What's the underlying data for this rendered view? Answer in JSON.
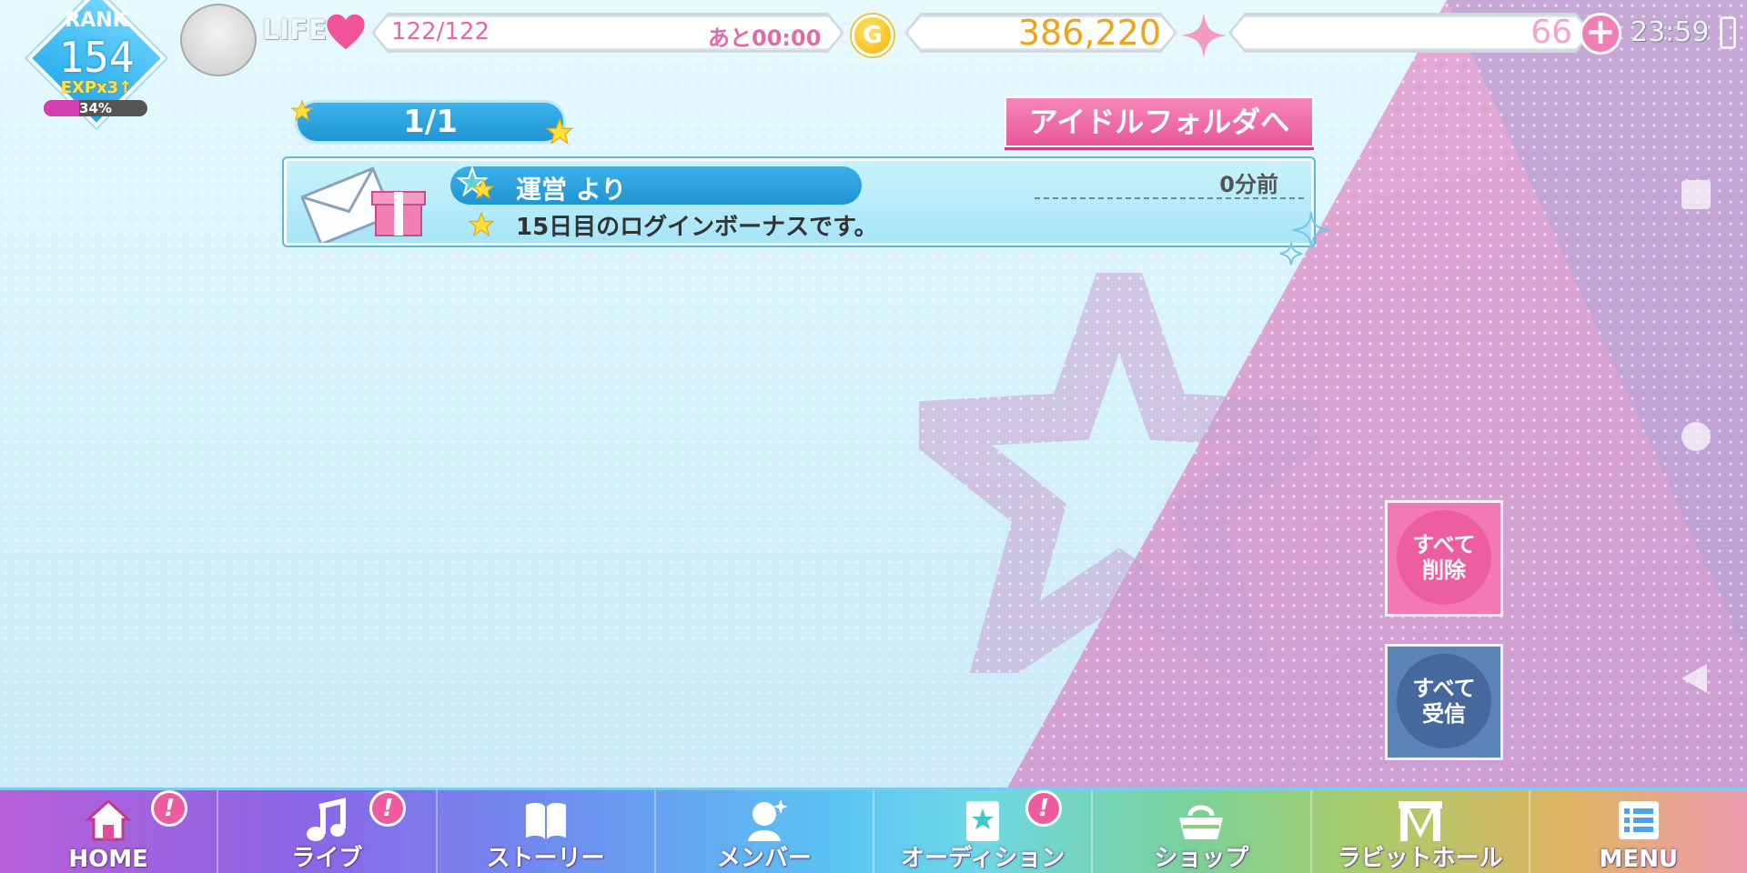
{
  "hud": {
    "rank_label": "RANK",
    "rank_value": "154",
    "exp_boost": "EXPx3↑",
    "exp_percent_text": "34%",
    "exp_progress": 0.34,
    "life_label": "LIFE",
    "life_value": "122/122",
    "life_timer": "あと00:00",
    "gold_icon": "G",
    "gold_value": "386,220",
    "jewel_value": "66",
    "plus_icon": "+",
    "clock": "23:59"
  },
  "content": {
    "page_indicator": "1/1",
    "folder_button": "アイドルフォルダへ",
    "messages": [
      {
        "sender": "運営 より",
        "time": "0分前",
        "body": "15日目のログインボーナスです。"
      }
    ],
    "delete_all": "すべて\n削除",
    "receive_all": "すべて\n受信"
  },
  "bottom_nav": [
    {
      "label": "HOME",
      "icon": "home-icon",
      "badge": "!"
    },
    {
      "label": "ライブ",
      "icon": "music-note-icon",
      "badge": "!"
    },
    {
      "label": "ストーリー",
      "icon": "book-icon",
      "badge": ""
    },
    {
      "label": "メンバー",
      "icon": "member-icon",
      "badge": ""
    },
    {
      "label": "オーディション",
      "icon": "audition-icon",
      "badge": "!"
    },
    {
      "label": "ショップ",
      "icon": "basket-icon",
      "badge": ""
    },
    {
      "label": "ラビットホール",
      "icon": "stage-icon",
      "badge": ""
    },
    {
      "label": "MENU",
      "icon": "menu-list-icon",
      "badge": ""
    }
  ],
  "colors": {
    "accent_pink": "#ec5e9f",
    "accent_blue": "#2094d3",
    "gold": "#f0a21c"
  }
}
